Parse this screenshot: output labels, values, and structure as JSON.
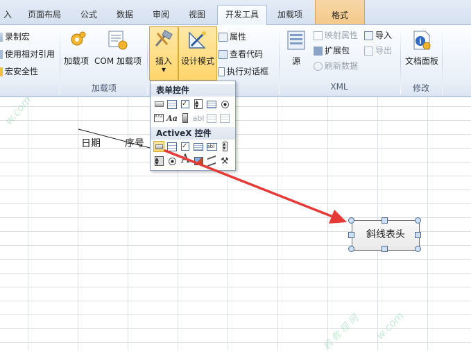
{
  "tabs": [
    {
      "id": "insert",
      "label": "入"
    },
    {
      "id": "layout",
      "label": "页面布局"
    },
    {
      "id": "formula",
      "label": "公式"
    },
    {
      "id": "data",
      "label": "数据"
    },
    {
      "id": "review",
      "label": "审阅"
    },
    {
      "id": "view",
      "label": "视图"
    },
    {
      "id": "developer",
      "label": "开发工具"
    },
    {
      "id": "addins",
      "label": "加载项"
    },
    {
      "id": "format",
      "label": "格式"
    }
  ],
  "code_group": {
    "record_macro": "录制宏",
    "relative_ref": "使用相对引用",
    "macro_security": "宏安全性"
  },
  "addins_group": {
    "addins": "加载项",
    "com_addins": "COM 加载项",
    "label": "加载项"
  },
  "controls_group": {
    "insert": "插入",
    "design_mode": "设计模式",
    "properties": "属性",
    "view_code": "查看代码",
    "run_dialog": "执行对话框"
  },
  "xml_group": {
    "source": "源",
    "map_properties": "映射属性",
    "expansion_pack": "扩展包",
    "refresh_data": "刷新数据",
    "import": "导入",
    "export": "导出",
    "label": "XML"
  },
  "modify_group": {
    "document_panel": "文档面板",
    "label": "修改"
  },
  "dropdown": {
    "form_controls": "表单控件",
    "activex_controls": "ActiveX 控件"
  },
  "sheet": {
    "date": "日期",
    "seq": "序号",
    "shape_text": "斜线表头"
  },
  "watermark": {
    "text1": "w.com",
    "text2": "w.com",
    "text3": "机 教 程 网"
  },
  "colors": {
    "accent_arrow": "#e53a35",
    "highlight": "#ffd56b"
  }
}
